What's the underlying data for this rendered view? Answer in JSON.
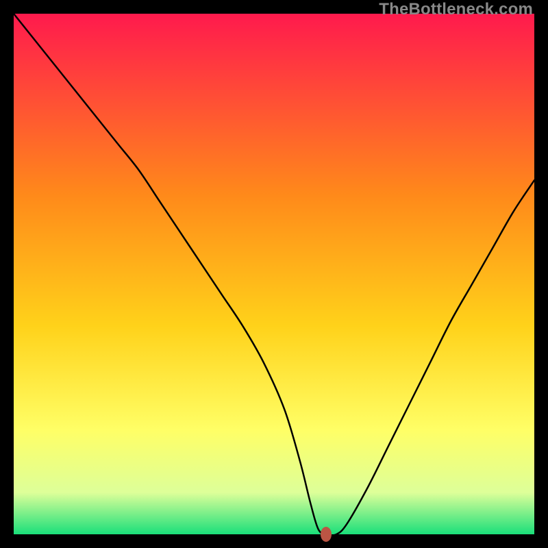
{
  "attribution": "TheBottleneck.com",
  "colors": {
    "gradient_top": "#ff1a4d",
    "gradient_mid1": "#ff8a1a",
    "gradient_mid2": "#ffd21a",
    "gradient_mid3": "#ffff66",
    "gradient_mid4": "#ddff99",
    "gradient_bottom": "#1adf7a",
    "curve": "#000000",
    "marker": "#bb5544",
    "frame": "#000000"
  },
  "chart_data": {
    "type": "line",
    "title": "",
    "xlabel": "",
    "ylabel": "",
    "xlim": [
      0,
      100
    ],
    "ylim": [
      0,
      100
    ],
    "x": [
      0,
      8,
      16,
      20,
      24,
      28,
      32,
      36,
      40,
      44,
      48,
      52,
      55,
      57,
      58.5,
      60,
      62,
      64,
      68,
      72,
      76,
      80,
      84,
      88,
      92,
      96,
      100
    ],
    "values": [
      100,
      90,
      80,
      75,
      70,
      64,
      58,
      52,
      46,
      40,
      33,
      24,
      14,
      6,
      1,
      0,
      0,
      2,
      9,
      17,
      25,
      33,
      41,
      48,
      55,
      62,
      68
    ],
    "marker": {
      "x": 60,
      "y": 0
    },
    "plateau": {
      "x_start": 57.5,
      "x_end": 62,
      "y": 0
    }
  }
}
